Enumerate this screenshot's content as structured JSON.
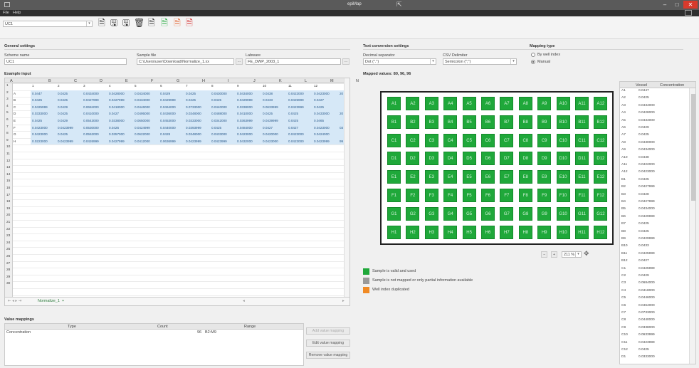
{
  "window": {
    "title": "epiMap"
  },
  "menu": [
    "File",
    "Help"
  ],
  "toolbar": {
    "combo_value": "UC1",
    "icons": [
      "new-file-icon",
      "save-icon",
      "save-as-icon",
      "delete-icon",
      "export-icon",
      "export-green-icon",
      "export-orange-icon",
      "export-red-icon"
    ]
  },
  "general": {
    "heading": "General settings",
    "scheme_label": "Scheme name",
    "scheme_value": "UC1",
    "sample_label": "Sample file",
    "sample_value": "C:\\Users\\user\\Download\\Normalize_1.xx",
    "labware_label": "Labware",
    "labware_value": "FE_DWP_2003_1"
  },
  "text_conv": {
    "heading": "Text conversion settings",
    "decimal_label": "Decimal separator",
    "decimal_value": "Dot (\".\")",
    "csv_label": "CSV Delimiter",
    "csv_value": "Semicolon (\";\")"
  },
  "mapping_type": {
    "heading": "Mapping type",
    "opt1": "By well index",
    "opt2": "Manual"
  },
  "example_input": {
    "heading": "Example input",
    "col_letters": [
      "A",
      "B",
      "C",
      "D",
      "E",
      "F",
      "G",
      "H",
      "I",
      "J",
      "K",
      "L",
      "M",
      "N"
    ],
    "row_numbers": [
      "1",
      "2",
      "3",
      "4",
      "5",
      "6",
      "7",
      "8",
      "9",
      "10",
      "11",
      "12",
      "13",
      "14",
      "15",
      "16",
      "17",
      "18",
      "19",
      "20",
      "21",
      "22",
      "23",
      "24",
      "25",
      "26",
      "27",
      "28",
      "29",
      "30"
    ],
    "row1": [
      "",
      "1",
      "2",
      "3",
      "4",
      "5",
      "6",
      "7",
      "8",
      "9",
      "10",
      "11",
      "12"
    ],
    "data_rows": [
      [
        "A",
        "0.0447",
        "0.0425",
        "0.0434000",
        "0.0428000",
        "0.0434000",
        "0.0429",
        "0.0425",
        "0.0430000",
        "0.0434000",
        "0.0438",
        "0.0422000",
        "0.0423000",
        "20"
      ],
      [
        "B",
        "0.0425",
        "0.0425",
        "0.0427999",
        "0.0427999",
        "0.0434000",
        "0.0429999",
        "0.0425",
        "0.0425",
        "0.0429999",
        "0.0433",
        "0.0425999",
        "0.0427",
        ""
      ],
      [
        "C",
        "0.0425999",
        "0.0429",
        "0.0684000",
        "0.0418000",
        "0.0446000",
        "0.0464000",
        "0.0733000",
        "0.0440000",
        "0.0338000",
        "0.0633999",
        "0.0423999",
        "0.0425",
        ""
      ],
      [
        "D",
        "0.0333000",
        "0.0425",
        "0.0410000",
        "0.0427",
        "0.0495000",
        "0.0436000",
        "0.0348000",
        "0.0488000",
        "0.0410000",
        "0.0425",
        "0.0425",
        "0.0433000",
        "20"
      ],
      [
        "E",
        "0.0425",
        "0.0429",
        "0.0543000",
        "0.0338000",
        "0.0650000",
        "0.0453000",
        "0.0333000",
        "0.0342000",
        "0.0363999",
        "0.0439999",
        "0.0425",
        "0.0465",
        ""
      ],
      [
        "F",
        "0.0423000",
        "0.0423999",
        "0.0530000",
        "0.0426",
        "0.0424999",
        "0.0440000",
        "0.0393999",
        "0.0425",
        "0.0484000",
        "0.0427",
        "0.0427",
        "0.0423000",
        "03"
      ],
      [
        "G",
        "0.0423000",
        "0.0425",
        "0.0552000",
        "0.0357000",
        "0.0622000",
        "0.0428",
        "0.0348000",
        "0.0433000",
        "0.0423000",
        "0.0420000",
        "0.0423000",
        "0.0424000",
        ""
      ],
      [
        "H",
        "0.0223000",
        "0.0423999",
        "0.0426999",
        "0.0427999",
        "0.0412000",
        "0.0636999",
        "0.0423999",
        "0.0423999",
        "0.0432000",
        "0.0423000",
        "0.0423000",
        "0.0423999",
        "99"
      ]
    ],
    "sheet_tab": "Normalize_1",
    "add_tab": "+"
  },
  "value_mappings": {
    "heading": "Value mappings",
    "col_type": "Type",
    "col_count": "Count",
    "col_range": "Range",
    "row_type": "Concentration",
    "row_count": "96",
    "row_range": "B2:M9",
    "btn_add": "Add value mapping",
    "btn_edit": "Edit value mapping",
    "btn_remove": "Remove value mapping"
  },
  "mapped": {
    "heading": "Mapped values: 80, 96, 96",
    "rows": [
      "A",
      "B",
      "C",
      "D",
      "E",
      "F",
      "G",
      "H"
    ],
    "cols": [
      "1",
      "2",
      "3",
      "4",
      "5",
      "6",
      "7",
      "8",
      "9",
      "10",
      "11",
      "12"
    ],
    "zoom": "211 %",
    "legend": [
      {
        "label": "Sample is valid and used",
        "color": "#1fa83a"
      },
      {
        "label": "Sample is not mapped or only partial information available",
        "color": "#9a9a9a"
      },
      {
        "label": "Well index duplicated",
        "color": "#f08a24"
      }
    ]
  },
  "right_table": {
    "col_vessel": "Vessel",
    "col_conc": "Concentration",
    "rows": [
      [
        "A1",
        "0.0447"
      ],
      [
        "A2",
        "0.0425"
      ],
      [
        "A3",
        "0.0434000"
      ],
      [
        "A4",
        "0.0428000"
      ],
      [
        "A5",
        "0.0434000"
      ],
      [
        "A6",
        "0.0429"
      ],
      [
        "A7",
        "0.0425"
      ],
      [
        "A8",
        "0.0430000"
      ],
      [
        "A9",
        "0.0434000"
      ],
      [
        "A10",
        "0.0438"
      ],
      [
        "A11",
        "0.0422000"
      ],
      [
        "A12",
        "0.0423000"
      ],
      [
        "B1",
        "0.0425"
      ],
      [
        "B2",
        "0.0427999"
      ],
      [
        "B3",
        "0.0428"
      ],
      [
        "B4",
        "0.0427999"
      ],
      [
        "B5",
        "0.0434000"
      ],
      [
        "B6",
        "0.0429999"
      ],
      [
        "B7",
        "0.0425"
      ],
      [
        "B8",
        "0.0425"
      ],
      [
        "B9",
        "0.0429999"
      ],
      [
        "B10",
        "0.0433"
      ],
      [
        "B11",
        "0.0425999"
      ],
      [
        "B12",
        "0.0427"
      ],
      [
        "C1",
        "0.0425999"
      ],
      [
        "C2",
        "0.0429"
      ],
      [
        "C3",
        "0.0684000"
      ],
      [
        "C4",
        "0.0418000"
      ],
      [
        "C5",
        "0.0446000"
      ],
      [
        "C6",
        "0.0464000"
      ],
      [
        "C7",
        "0.0733000"
      ],
      [
        "C8",
        "0.0440000"
      ],
      [
        "C9",
        "0.0338000"
      ],
      [
        "C10",
        "0.0633999"
      ],
      [
        "C11",
        "0.0423999"
      ],
      [
        "C12",
        "0.0425"
      ],
      [
        "D1",
        "0.0333000"
      ]
    ]
  }
}
